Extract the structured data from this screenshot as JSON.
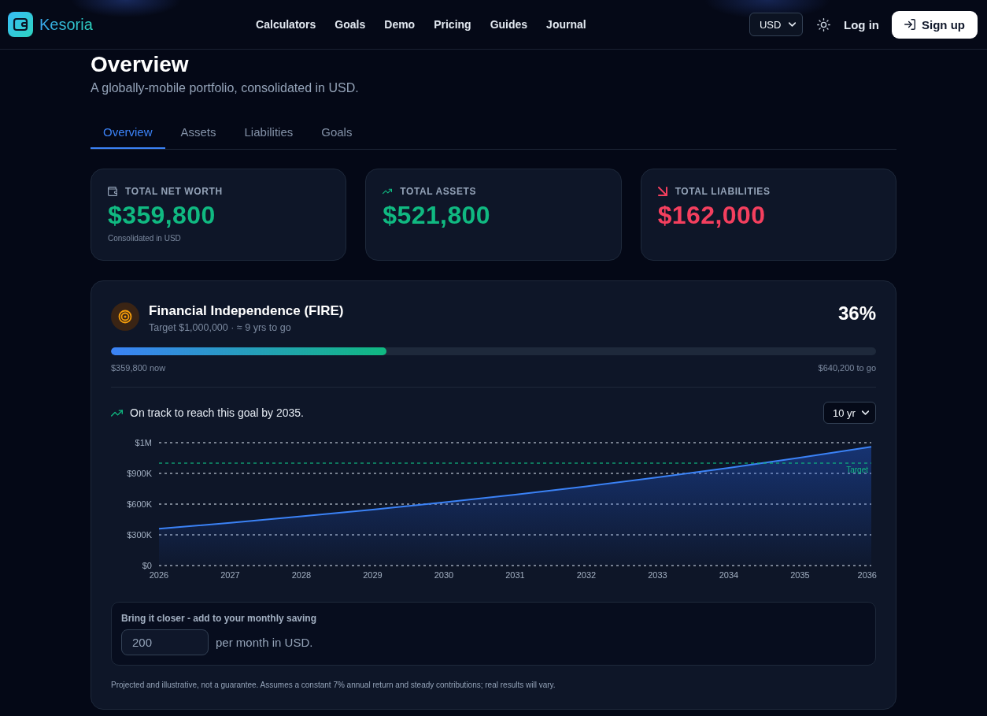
{
  "header": {
    "brand": "Kesoria",
    "nav": [
      "Calculators",
      "Goals",
      "Demo",
      "Pricing",
      "Guides",
      "Journal"
    ],
    "currency": "USD",
    "login": "Log in",
    "signup": "Sign up"
  },
  "title": "Overview",
  "subtitle": "A globally-mobile portfolio, consolidated in USD.",
  "tabs": [
    {
      "label": "Overview",
      "selected": true
    },
    {
      "label": "Assets",
      "selected": false
    },
    {
      "label": "Liabilities",
      "selected": false
    },
    {
      "label": "Goals",
      "selected": false
    }
  ],
  "stats": [
    {
      "kind": "wallet",
      "label": "TOTAL NET WORTH",
      "value": "$359,800",
      "color": "#10b981",
      "note": "Consolidated in USD"
    },
    {
      "kind": "up",
      "label": "TOTAL ASSETS",
      "value": "$521,800",
      "color": "#10b981"
    },
    {
      "kind": "down",
      "label": "TOTAL LIABILITIES",
      "value": "$162,000",
      "color": "#f43f5e"
    }
  ],
  "goal": {
    "title": "Financial Independence (FIRE)",
    "subtitle": "Target $1,000,000 · ≈ 9 yrs to go",
    "percent": "36%",
    "level": 0.36,
    "now": "$359,800 now",
    "to_go": "$640,200 to go",
    "status": "On track to reach this goal by 2035.",
    "horizon": "10 yr",
    "chart_data": {
      "type": "area",
      "categories": [
        "2026",
        "2027",
        "2028",
        "2029",
        "2030",
        "2031",
        "2032",
        "2033",
        "2034",
        "2035",
        "2036"
      ],
      "values": [
        360000,
        418000,
        480000,
        546000,
        617000,
        693000,
        774000,
        861000,
        954000,
        1053000,
        1160000
      ],
      "ylim": [
        0,
        1200000
      ],
      "yticks": [
        {
          "value": 0,
          "label": "$0"
        },
        {
          "value": 300000,
          "label": "$300K"
        },
        {
          "value": 600000,
          "label": "$600K"
        },
        {
          "value": 900000,
          "label": "$900K"
        },
        {
          "value": 1200000,
          "label": "$1M"
        }
      ],
      "grid": true,
      "ref_lines": [
        {
          "axis": "y",
          "value": 1000000,
          "label": "Target"
        }
      ]
    },
    "boost": {
      "label": "Bring it closer - add to your monthly saving",
      "value": "200",
      "suffix": "per month in USD."
    },
    "disclaimer": "Projected and illustrative, not a guarantee. Assumes a constant 7% annual return and steady contributions; real results will vary."
  }
}
